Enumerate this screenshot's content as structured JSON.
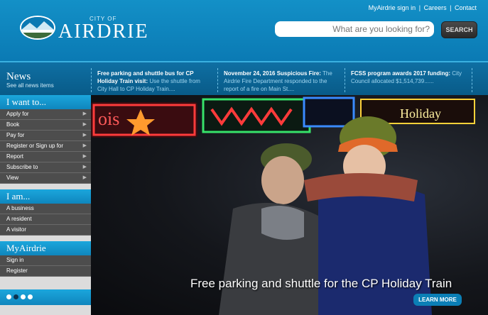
{
  "header": {
    "logo_city_of": "CITY OF",
    "logo_name": "AIRDRIE",
    "util_links": [
      "MyAirdrie sign in",
      "Careers",
      "Contact"
    ],
    "search_placeholder": "What are you looking for?",
    "search_button": "SEARCH"
  },
  "news": {
    "label": "News",
    "see_all": "See all news items",
    "items": [
      {
        "title": "Free parking and shuttle bus for CP Holiday Train visit:",
        "body": "Use the shuttle from City Hall to CP Holiday Train...."
      },
      {
        "title": "November 24, 2016 Suspicious Fire:",
        "body": "The Airdrie Fire Department responded to the report of a fire on Main St...."
      },
      {
        "title": "FCSS program awards 2017 funding:",
        "body": "City Council allocated $1,514,739......"
      }
    ]
  },
  "sidebar": {
    "i_want_to": {
      "heading": "I want to...",
      "items": [
        "Apply for",
        "Book",
        "Pay for",
        "Register or Sign up for",
        "Report",
        "Subscribe to",
        "View"
      ]
    },
    "i_am": {
      "heading": "I am...",
      "items": [
        "A business",
        "A resident",
        "A visitor"
      ]
    },
    "myairdrie": {
      "heading": "MyAirdrie",
      "items": [
        "Sign in",
        "Register"
      ]
    }
  },
  "slider": {
    "caption": "Free parking and shuttle for the CP Holiday Train",
    "button": "LEARN MORE",
    "dots_count": 4,
    "active_dot": 1
  },
  "colors": {
    "brand_blue": "#0a79b3",
    "accent": "#1ba6dc"
  }
}
